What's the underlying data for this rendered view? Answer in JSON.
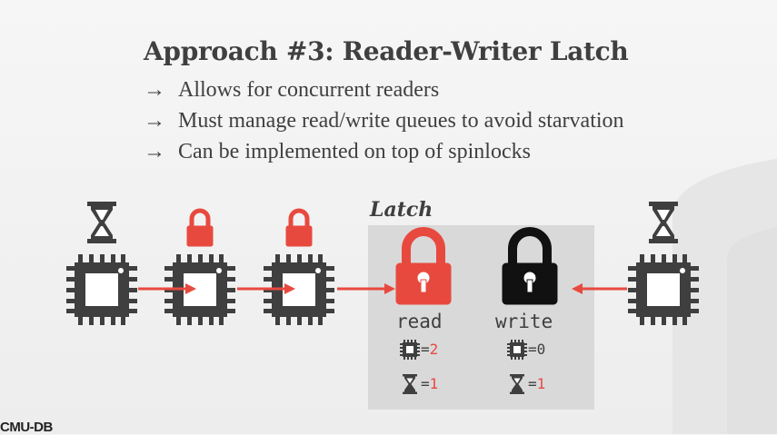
{
  "slide": {
    "title": "Approach #3: Reader-Writer Latch",
    "bullets": [
      {
        "arrow": "→",
        "text": "Allows for concurrent readers"
      },
      {
        "arrow": "→",
        "text": "Must manage read/write queues to avoid starvation"
      },
      {
        "arrow": "→",
        "text": "Can be implemented on top of spinlocks"
      }
    ]
  },
  "latch": {
    "title": "Latch",
    "read": {
      "label": "read",
      "cpu_prefix": "=",
      "cpu_count": "2",
      "wait_prefix": "=",
      "wait_count": "1"
    },
    "write": {
      "label": "write",
      "cpu_prefix": "=",
      "cpu_count": "0",
      "wait_prefix": "=",
      "wait_count": "1"
    }
  },
  "footer": {
    "text": "CMU-DB"
  },
  "colors": {
    "red": "#e8493f",
    "dark": "#3f3f3f",
    "latch_bg": "#d9d9d9",
    "black_lock": "#111111"
  },
  "icons": [
    "hourglass-icon",
    "padlock-icon",
    "cpu-icon",
    "arrow-icon"
  ]
}
